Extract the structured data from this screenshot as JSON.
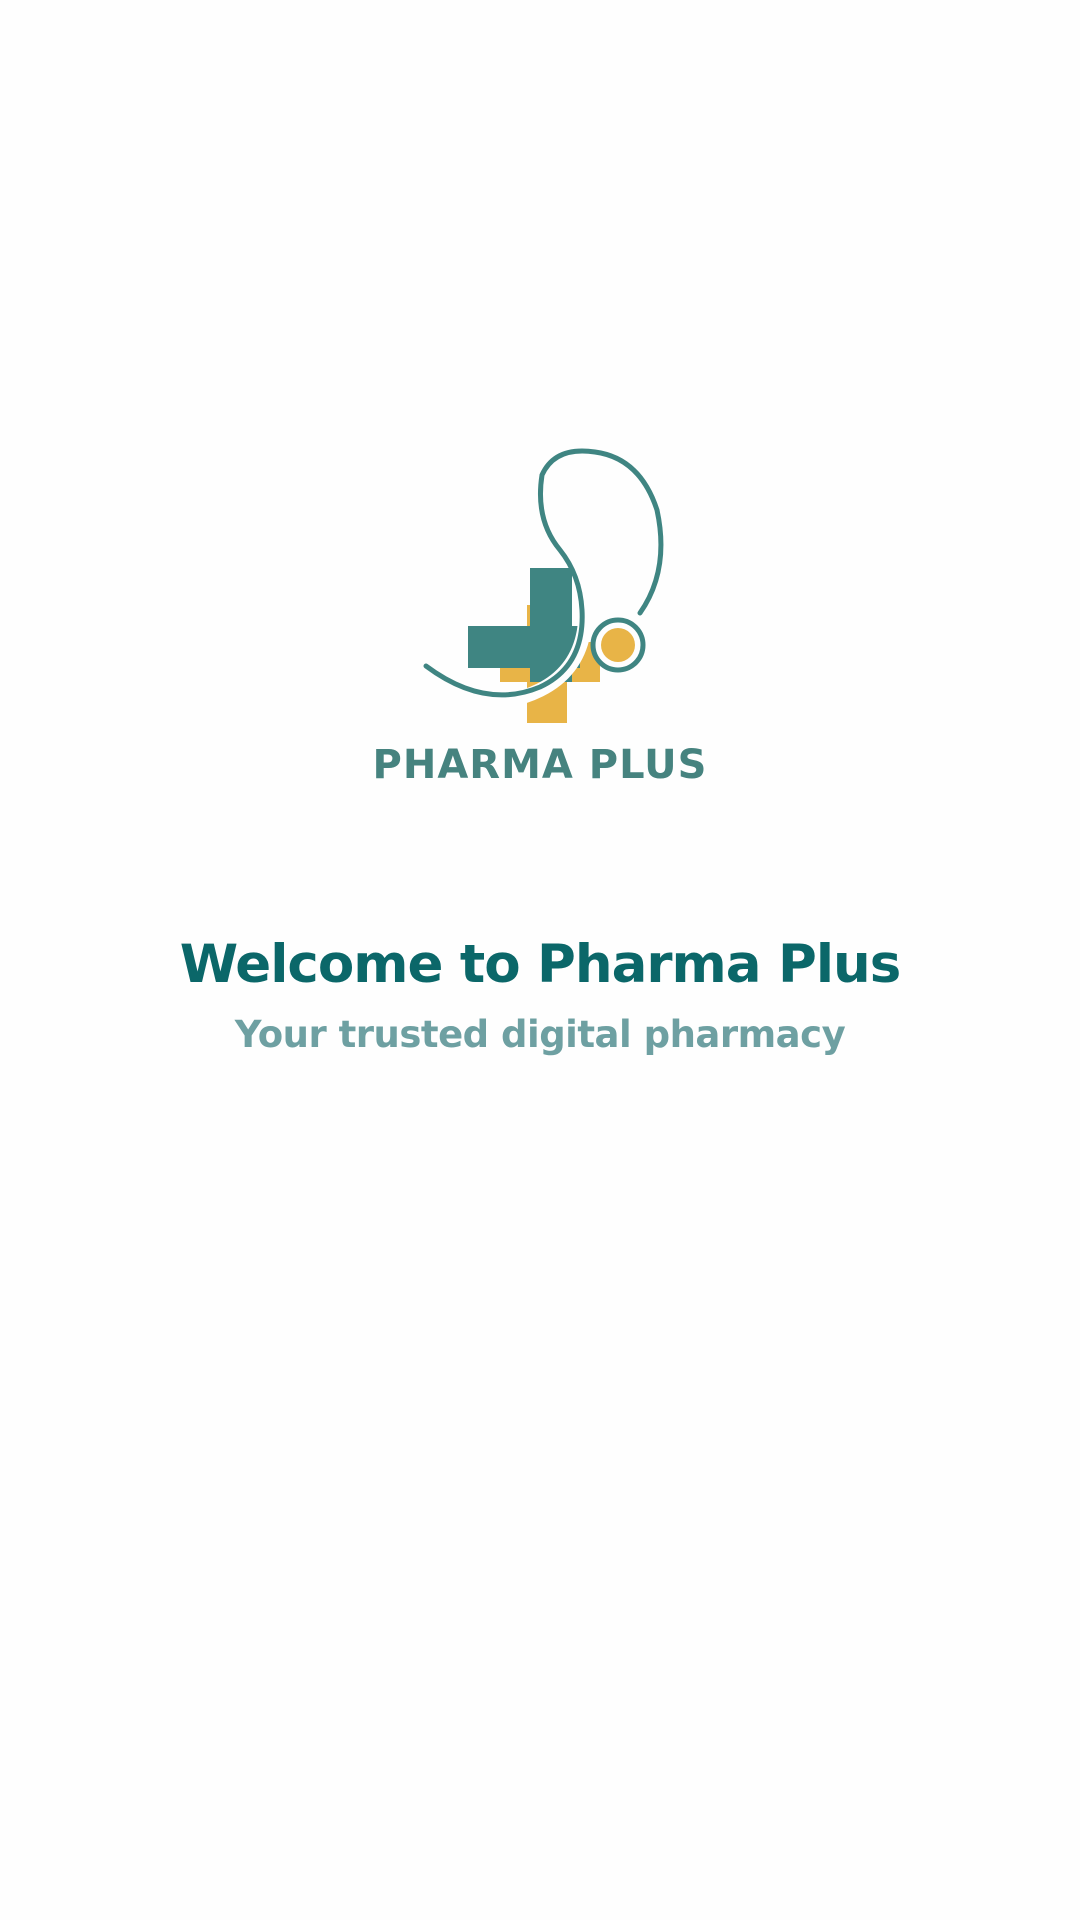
{
  "brand": {
    "logo_text": "PHARMA PLUS",
    "colors": {
      "teal": "#3f8582",
      "gold": "#e8b447",
      "title": "#0b6769",
      "subtitle": "#6ea0a2",
      "background": "#fefefe"
    },
    "icon": "stethoscope-plus-icon"
  },
  "welcome": {
    "title": "Welcome to Pharma Plus",
    "subtitle": "Your trusted digital pharmacy"
  }
}
